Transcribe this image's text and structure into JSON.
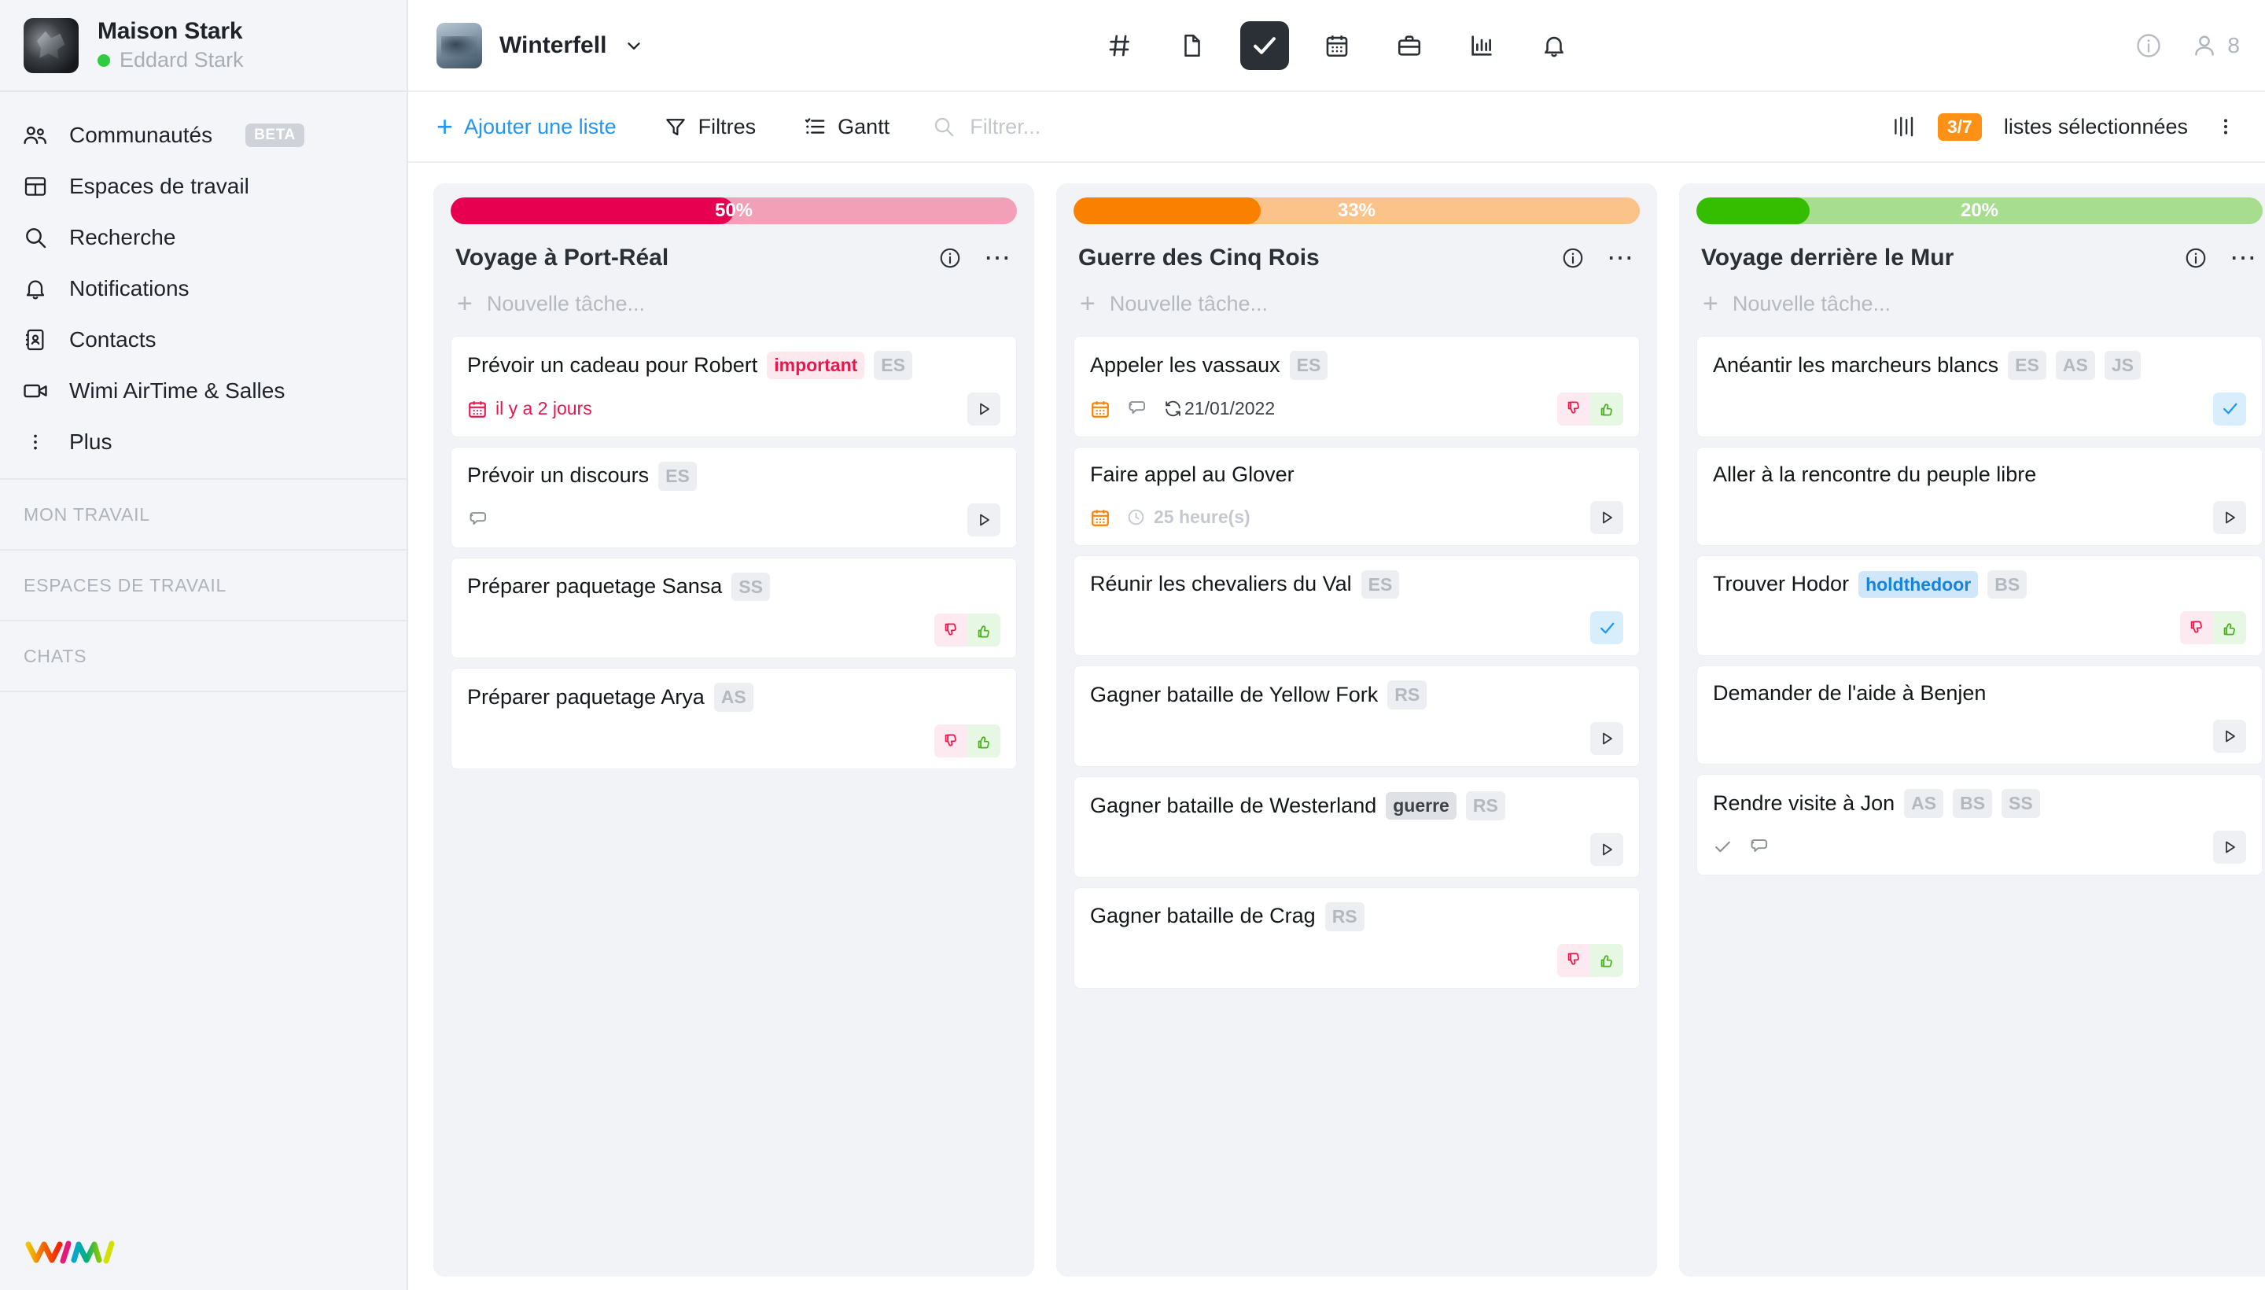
{
  "sidebar": {
    "workspace": {
      "name": "Maison Stark",
      "user": "Eddard Stark",
      "status": "online"
    },
    "nav": [
      {
        "label": "Communautés",
        "icon": "people-icon",
        "badge": "BETA"
      },
      {
        "label": "Espaces de travail",
        "icon": "grid-icon",
        "badge": ""
      },
      {
        "label": "Recherche",
        "icon": "search-icon",
        "badge": ""
      },
      {
        "label": "Notifications",
        "icon": "bell-icon",
        "badge": ""
      },
      {
        "label": "Contacts",
        "icon": "contact-book-icon",
        "badge": ""
      },
      {
        "label": "Wimi AirTime & Salles",
        "icon": "video-camera-icon",
        "badge": ""
      },
      {
        "label": "Plus",
        "icon": "dots-vertical-icon",
        "badge": ""
      }
    ],
    "sections": [
      {
        "label": "MON TRAVAIL"
      },
      {
        "label": "ESPACES DE TRAVAIL"
      },
      {
        "label": "CHATS"
      }
    ],
    "logo": "wimi-logo"
  },
  "topbar": {
    "project": "Winterfell",
    "icons": [
      {
        "name": "channels-hash-icon",
        "glyph": "#",
        "active": false
      },
      {
        "name": "documents-icon",
        "glyph": "doc",
        "active": false
      },
      {
        "name": "tasks-check-icon",
        "glyph": "check",
        "active": true
      },
      {
        "name": "calendar-icon",
        "glyph": "calendar",
        "active": false
      },
      {
        "name": "briefcase-icon",
        "glyph": "briefcase",
        "active": false
      },
      {
        "name": "reports-chart-icon",
        "glyph": "chart",
        "active": false
      },
      {
        "name": "notifications-bell-icon",
        "glyph": "bell",
        "active": false
      }
    ],
    "info_icon": "info-circle-icon",
    "members_count": "8"
  },
  "toolbar": {
    "add_list": "Ajouter une liste",
    "filters": "Filtres",
    "gantt": "Gantt",
    "search_value": "",
    "search_placeholder": "Filtrer...",
    "selected_badge": "3/7",
    "selected_label": "listes sélectionnées"
  },
  "board": {
    "new_task_placeholder": "Nouvelle tâche...",
    "columns": [
      {
        "title": "Voyage à Port-Réal",
        "percent": "50%",
        "percent_value": 50,
        "color": "#e6004f",
        "track": "#f2a0b8",
        "tasks": [
          {
            "title": "Prévoir un cadeau pour Robert",
            "tags": [
              {
                "label": "important",
                "style": "important"
              }
            ],
            "initials": [
              "ES"
            ],
            "due": "il y a 2 jours",
            "due_state": "overdue",
            "has_comments": false,
            "has_subtasks": false,
            "recurrence": "",
            "duration": "",
            "action": "play"
          },
          {
            "title": "Prévoir un discours",
            "tags": [],
            "initials": [
              "ES"
            ],
            "due": "",
            "due_state": "",
            "has_comments": true,
            "has_subtasks": false,
            "recurrence": "",
            "duration": "",
            "action": "play"
          },
          {
            "title": "Préparer paquetage Sansa",
            "tags": [],
            "initials": [
              "SS"
            ],
            "due": "",
            "due_state": "",
            "has_comments": false,
            "has_subtasks": false,
            "recurrence": "",
            "duration": "",
            "action": "validate"
          },
          {
            "title": "Préparer paquetage Arya",
            "tags": [],
            "initials": [
              "AS"
            ],
            "due": "",
            "due_state": "",
            "has_comments": false,
            "has_subtasks": false,
            "recurrence": "",
            "duration": "",
            "action": "validate"
          }
        ]
      },
      {
        "title": "Guerre des Cinq Rois",
        "percent": "33%",
        "percent_value": 33,
        "color": "#f98000",
        "track": "#fbc389",
        "tasks": [
          {
            "title": "Appeler les vassaux",
            "tags": [],
            "initials": [
              "ES"
            ],
            "due": "",
            "due_state": "orange-cal",
            "has_comments": true,
            "has_subtasks": false,
            "recurrence": "21/01/2022",
            "duration": "",
            "action": "validate"
          },
          {
            "title": "Faire appel au Glover",
            "tags": [],
            "initials": [],
            "due": "",
            "due_state": "orange-cal",
            "has_comments": false,
            "has_subtasks": false,
            "recurrence": "",
            "duration": "25 heure(s)",
            "action": "play"
          },
          {
            "title": "Réunir les chevaliers du Val",
            "tags": [],
            "initials": [
              "ES"
            ],
            "due": "",
            "due_state": "",
            "has_comments": false,
            "has_subtasks": false,
            "recurrence": "",
            "duration": "",
            "action": "check"
          },
          {
            "title": "Gagner bataille de Yellow Fork",
            "tags": [],
            "initials": [
              "RS"
            ],
            "due": "",
            "due_state": "",
            "has_comments": false,
            "has_subtasks": false,
            "recurrence": "",
            "duration": "",
            "action": "play"
          },
          {
            "title": "Gagner bataille de Westerland",
            "tags": [
              {
                "label": "guerre",
                "style": "guerre"
              }
            ],
            "initials": [
              "RS"
            ],
            "due": "",
            "due_state": "",
            "has_comments": false,
            "has_subtasks": false,
            "recurrence": "",
            "duration": "",
            "action": "play"
          },
          {
            "title": "Gagner bataille de Crag",
            "tags": [],
            "initials": [
              "RS"
            ],
            "due": "",
            "due_state": "",
            "has_comments": false,
            "has_subtasks": false,
            "recurrence": "",
            "duration": "",
            "action": "validate"
          }
        ]
      },
      {
        "title": "Voyage derrière le Mur",
        "percent": "20%",
        "percent_value": 20,
        "color": "#35bd00",
        "track": "#a6dd8f",
        "tasks": [
          {
            "title": "Anéantir les marcheurs blancs",
            "tags": [],
            "initials": [
              "ES",
              "AS",
              "JS"
            ],
            "due": "",
            "due_state": "",
            "has_comments": false,
            "has_subtasks": false,
            "recurrence": "",
            "duration": "",
            "action": "check"
          },
          {
            "title": "Aller à la rencontre du peuple libre",
            "tags": [],
            "initials": [],
            "due": "",
            "due_state": "",
            "has_comments": false,
            "has_subtasks": false,
            "recurrence": "",
            "duration": "",
            "action": "play"
          },
          {
            "title": "Trouver Hodor",
            "tags": [
              {
                "label": "holdthedoor",
                "style": "hold"
              }
            ],
            "initials": [
              "BS"
            ],
            "due": "",
            "due_state": "",
            "has_comments": false,
            "has_subtasks": false,
            "recurrence": "",
            "duration": "",
            "action": "validate"
          },
          {
            "title": "Demander de l'aide à Benjen",
            "tags": [],
            "initials": [],
            "due": "",
            "due_state": "",
            "has_comments": false,
            "has_subtasks": false,
            "recurrence": "",
            "duration": "",
            "action": "play"
          },
          {
            "title": "Rendre visite à Jon",
            "tags": [],
            "initials": [
              "AS",
              "BS",
              "SS"
            ],
            "due": "",
            "due_state": "",
            "has_comments": true,
            "has_subtasks": true,
            "recurrence": "",
            "duration": "",
            "action": "play"
          }
        ]
      }
    ]
  }
}
